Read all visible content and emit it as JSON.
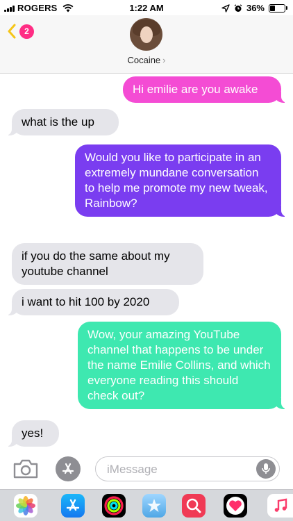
{
  "status_bar": {
    "carrier": "ROGERS",
    "time": "1:22 AM",
    "battery_percent": "36%",
    "battery_level": 0.36,
    "icons": [
      "signal-icon",
      "wifi-icon",
      "location-icon",
      "alarm-icon",
      "battery-icon"
    ]
  },
  "header": {
    "unread_count": "2",
    "contact_name": "Cocaine",
    "contact_chevron": "›"
  },
  "messages": [
    {
      "direction": "sent",
      "text": "Hi emilie are you awake",
      "color": "#f44cd4"
    },
    {
      "direction": "received",
      "text": "what is the up"
    },
    {
      "direction": "sent",
      "text": "Would you like to participate in an extremely mundane conversation to help me promote my new tweak, Rainbow?",
      "color": "#7a3df0"
    },
    {
      "direction": "received",
      "text": "if you do the same about my youtube channel"
    },
    {
      "direction": "received",
      "text": "i want to hit 100 by 2020"
    },
    {
      "direction": "sent",
      "text": "Wow, your amazing YouTube channel that happens to be under the name Emilie Collins, and which everyone reading this should check out?",
      "color": "#3ee8b0"
    },
    {
      "direction": "received",
      "text": "yes!"
    }
  ],
  "input_bar": {
    "placeholder": "iMessage"
  },
  "app_drawer": {
    "apps": [
      "photos-app-icon",
      "app-store-icon",
      "activity-app-icon",
      "stickers-app-icon",
      "search-app-icon",
      "heart-app-icon",
      "music-app-icon"
    ]
  },
  "colors": {
    "received_bubble": "#e5e5ea",
    "badge": "#ff2d84",
    "back_chevron": "#f5c518"
  }
}
